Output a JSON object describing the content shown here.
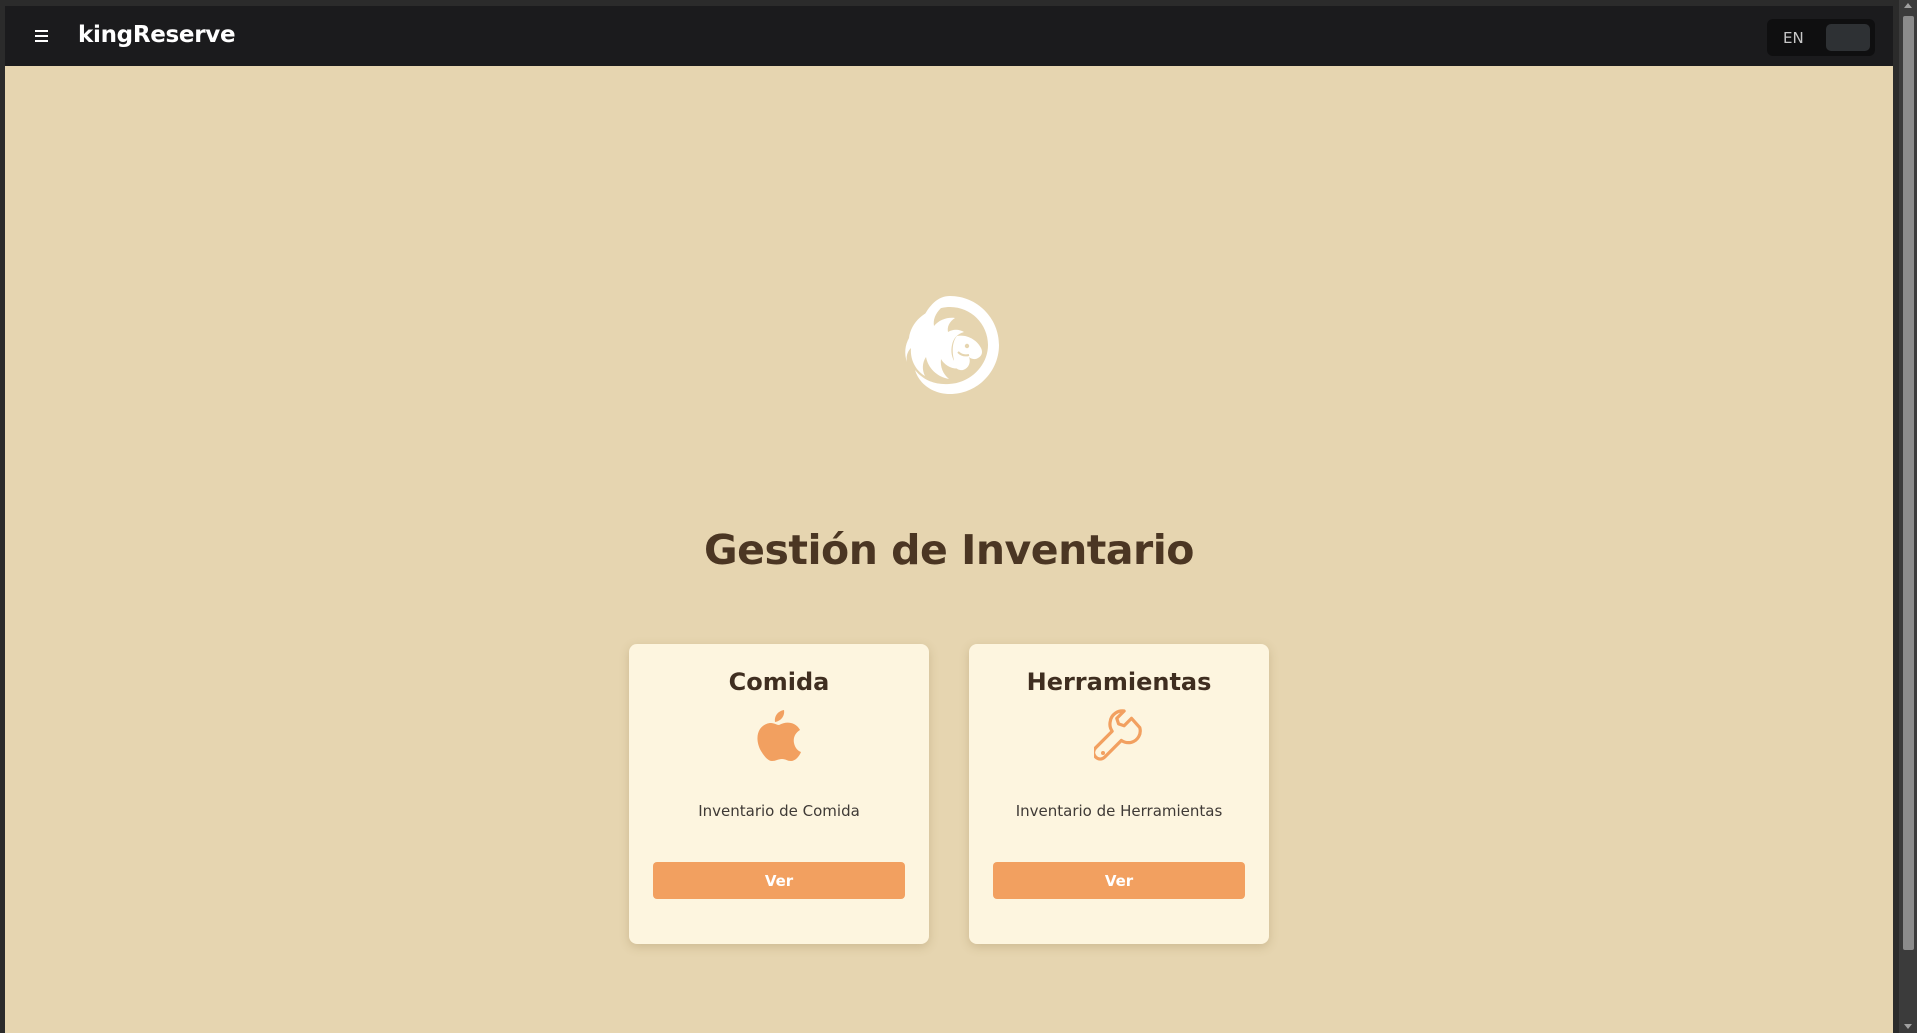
{
  "header": {
    "brand": "kingReserve",
    "menu_icon": "hamburger-menu-icon",
    "language_label": "EN"
  },
  "hero": {
    "logo_icon": "lion-head-logo",
    "title": "Gestión de Inventario"
  },
  "cards": [
    {
      "title": "Comida",
      "icon": "apple-icon",
      "description": "Inventario de Comida",
      "button_label": "Ver"
    },
    {
      "title": "Herramientas",
      "icon": "wrench-icon",
      "description": "Inventario de Herramientas",
      "button_label": "Ver"
    }
  ],
  "colors": {
    "page_background": "#e6d5b0",
    "topbar": "#1b1b1d",
    "card_background": "#fdf5df",
    "accent": "#f2a060",
    "title_text": "#4b3623"
  }
}
